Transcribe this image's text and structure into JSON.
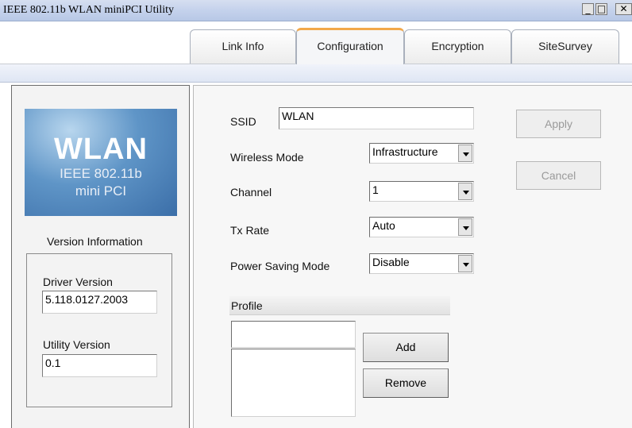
{
  "window": {
    "title": "IEEE 802.11b WLAN miniPCI Utility",
    "minimize_glyph": "_",
    "maximize_glyph": "□",
    "close_glyph": "✕"
  },
  "tabs": [
    {
      "label": "Link Info"
    },
    {
      "label": "Configuration",
      "active": true
    },
    {
      "label": "Encryption"
    },
    {
      "label": "SiteSurvey"
    }
  ],
  "left": {
    "logo": {
      "title": "WLAN",
      "line1": "IEEE 802.11b",
      "line2": "mini PCI"
    },
    "version_info_label": "Version Information",
    "driver_version_label": "Driver Version",
    "driver_version": "5.118.0127.2003",
    "utility_version_label": "Utility Version",
    "utility_version": "0.1"
  },
  "config": {
    "ssid_label": "SSID",
    "ssid_value": "WLAN",
    "wireless_mode_label": "Wireless Mode",
    "wireless_mode_value": "Infrastructure",
    "channel_label": "Channel",
    "channel_value": "1",
    "tx_rate_label": "Tx Rate",
    "tx_rate_value": "Auto",
    "power_saving_label": "Power Saving Mode",
    "power_saving_value": "Disable",
    "apply_label": "Apply",
    "cancel_label": "Cancel"
  },
  "profile": {
    "header": "Profile",
    "add_label": "Add",
    "remove_label": "Remove"
  },
  "colors": {
    "active_tab_accent": "#f2a84a",
    "title_bar": "#c4d2ec",
    "logo_blue": "#3b6ea8"
  }
}
